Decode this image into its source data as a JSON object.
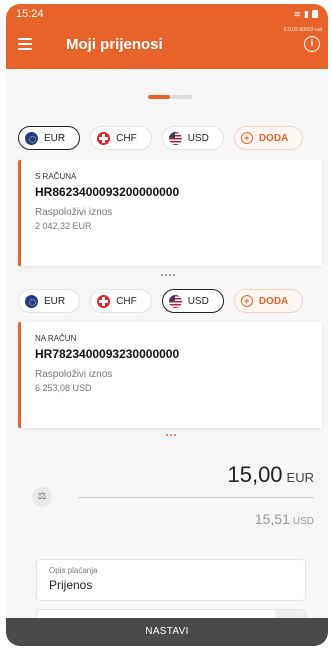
{
  "status_bar": {
    "time": "15:24"
  },
  "app_bar": {
    "title": "Moji prijenosi",
    "version": "6.0.02-80002-uat",
    "info_glyph": "i"
  },
  "currency_chips": [
    {
      "code": "EUR",
      "icon": "eu-flag-icon"
    },
    {
      "code": "CHF",
      "icon": "swiss-flag-icon"
    },
    {
      "code": "USD",
      "icon": "us-flag-icon"
    }
  ],
  "add_label": "DODA",
  "from_account": {
    "selected_currency": "EUR",
    "label": "S RAČUNA",
    "iban": "HR8623400093200000000",
    "balance_label": "Raspoloživi iznos",
    "balance": "2 042,32 EUR"
  },
  "to_account": {
    "selected_currency": "USD",
    "label": "NA RAČUN",
    "iban": "HR7823400093230000000",
    "balance_label": "Raspoloživi iznos",
    "balance": "6 253,08 USD"
  },
  "conversion": {
    "amount": "15,00",
    "currency": "EUR",
    "converted_amount": "15,51",
    "converted_currency": "USD"
  },
  "description_field": {
    "label": "Opis plaćanja",
    "value": "Prijenos"
  },
  "primary_button": "NASTAVI",
  "colors": {
    "accent": "#e8632a",
    "button": "#4a4a4a"
  }
}
